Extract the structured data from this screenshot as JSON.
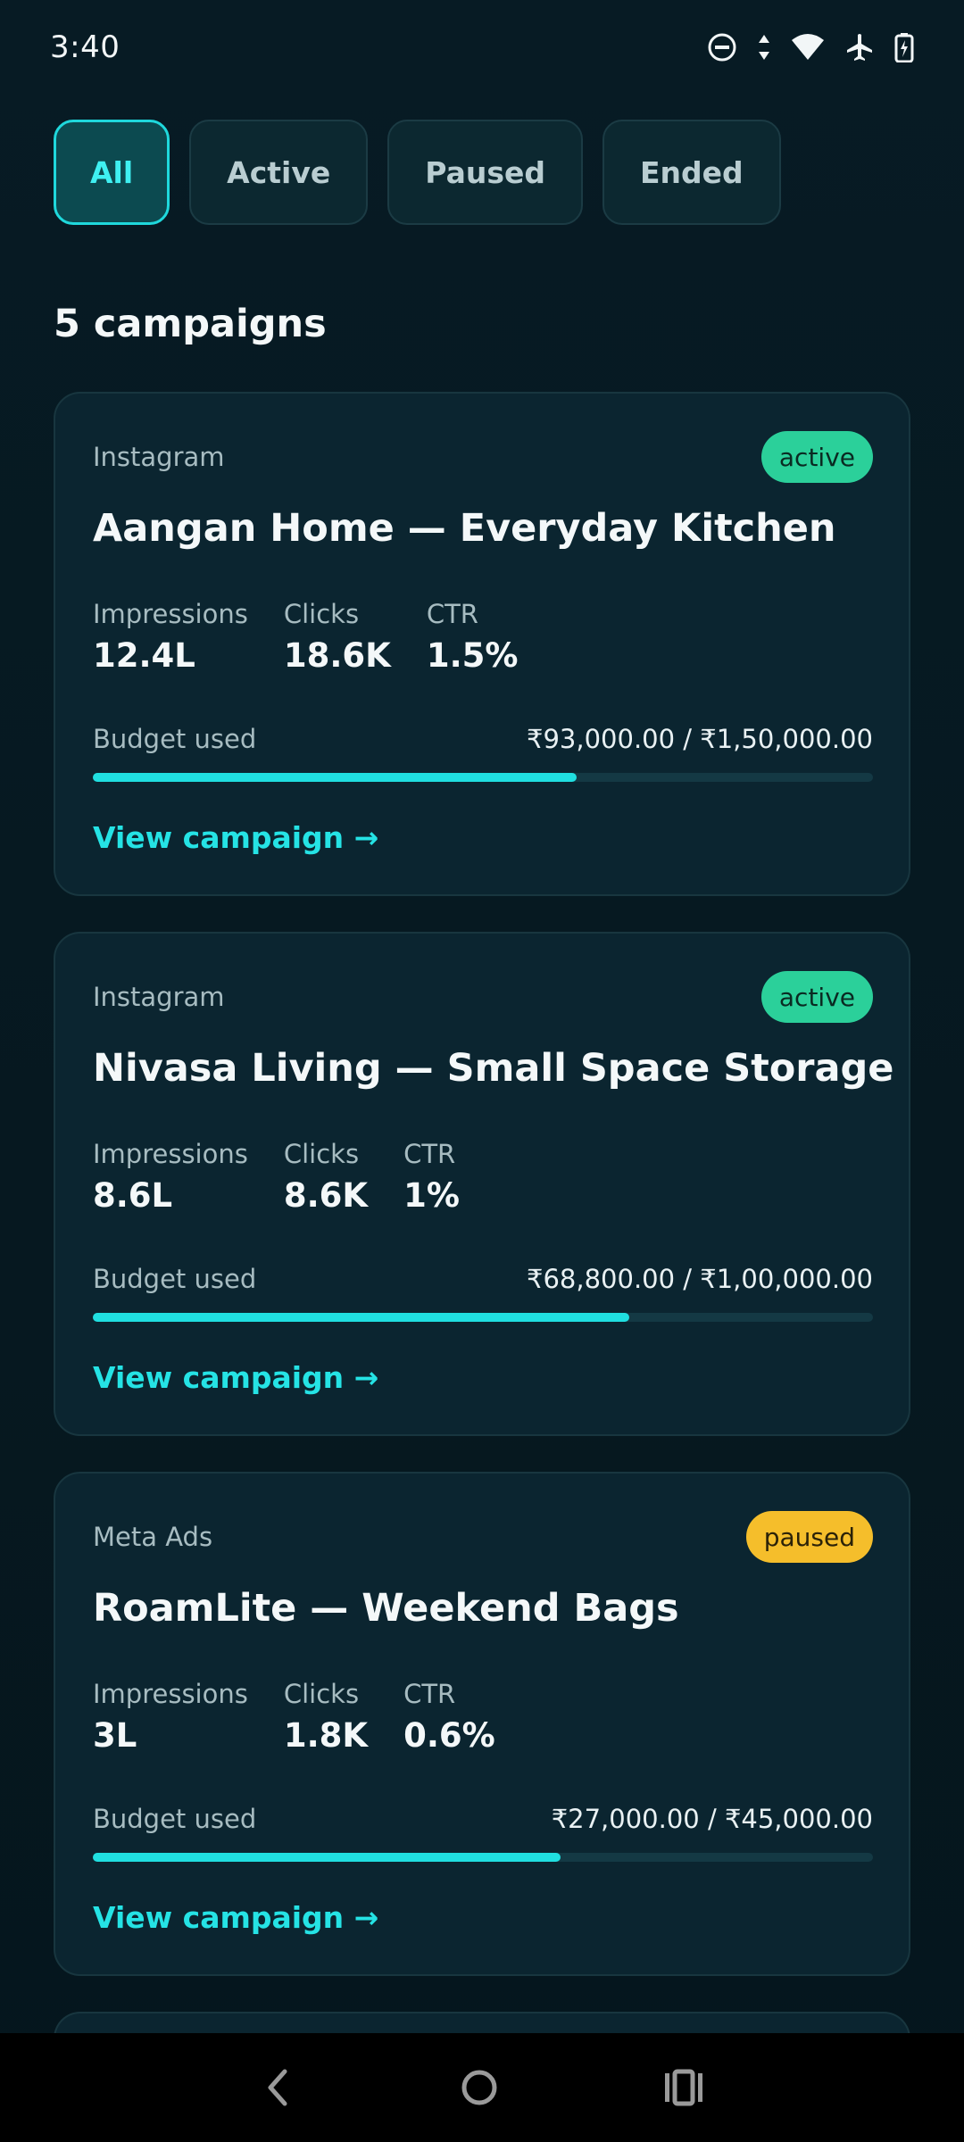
{
  "status_bar": {
    "time": "3:40",
    "icons": [
      "do-not-disturb-icon",
      "data-arrows-icon",
      "wifi-icon",
      "airplane-mode-icon",
      "battery-charging-icon"
    ]
  },
  "filters": {
    "chips": [
      {
        "label": "All",
        "selected": true
      },
      {
        "label": "Active",
        "selected": false
      },
      {
        "label": "Paused",
        "selected": false
      },
      {
        "label": "Ended",
        "selected": false
      }
    ]
  },
  "campaign_count": "5 campaigns",
  "labels": {
    "impressions": "Impressions",
    "clicks": "Clicks",
    "ctr": "CTR",
    "budget_used": "Budget used",
    "view_campaign": "View campaign →"
  },
  "campaigns": [
    {
      "platform": "Instagram",
      "status": "active",
      "title": "Aangan Home — Everyday Kitchen",
      "impressions": "12.4L",
      "clicks": "18.6K",
      "ctr": "1.5%",
      "budget": "₹93,000.00 / ₹1,50,000.00",
      "budget_fraction": 0.62
    },
    {
      "platform": "Instagram",
      "status": "active",
      "title": "Nivasa Living — Small Space Storage",
      "impressions": "8.6L",
      "clicks": "8.6K",
      "ctr": "1%",
      "budget": "₹68,800.00 / ₹1,00,000.00",
      "budget_fraction": 0.688
    },
    {
      "platform": "Meta Ads",
      "status": "paused",
      "title": "RoamLite — Weekend Bags",
      "impressions": "3L",
      "clicks": "1.8K",
      "ctr": "0.6%",
      "budget": "₹27,000.00 / ₹45,000.00",
      "budget_fraction": 0.6
    }
  ],
  "colors": {
    "accent": "#20dfe0",
    "active_badge": "#2bd09a",
    "paused_badge": "#f5be2b",
    "background": "#061820",
    "card": "#0b2530"
  },
  "nav_bar": {
    "icons": [
      "back-icon",
      "home-icon",
      "recents-icon"
    ]
  }
}
